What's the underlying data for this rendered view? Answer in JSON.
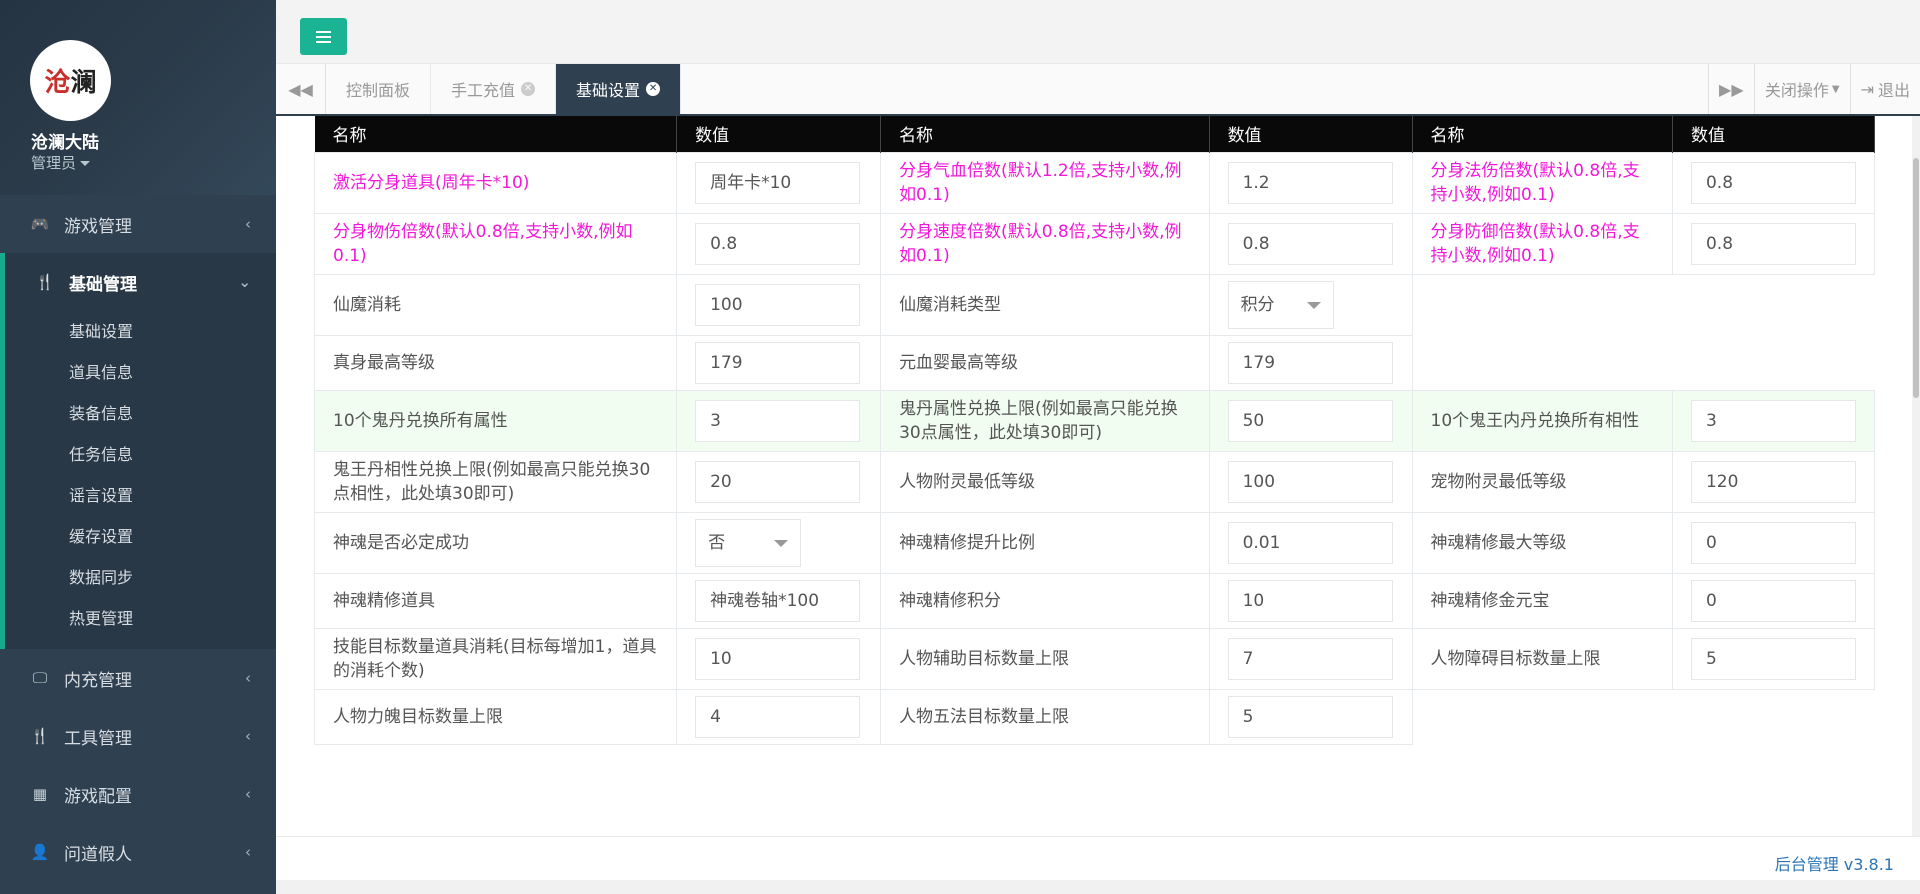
{
  "sidebar": {
    "name": "沧澜大陆",
    "role": "管理员",
    "logo": [
      "沧",
      "澜"
    ],
    "groups": [
      {
        "label": "游戏管理",
        "icon": "gamepad-icon"
      },
      {
        "label": "基础管理",
        "icon": "cutlery-icon",
        "active": true,
        "children": [
          "基础设置",
          "道具信息",
          "装备信息",
          "任务信息",
          "谣言设置",
          "缓存设置",
          "数据同步",
          "热更管理"
        ]
      },
      {
        "label": "内充管理",
        "icon": "desktop-icon"
      },
      {
        "label": "工具管理",
        "icon": "cutlery-icon"
      },
      {
        "label": "游戏配置",
        "icon": "table-icon"
      },
      {
        "label": "问道假人",
        "icon": "user-icon"
      }
    ]
  },
  "tabs": [
    {
      "label": "控制面板",
      "closable": false
    },
    {
      "label": "手工充值",
      "closable": true
    },
    {
      "label": "基础设置",
      "closable": true,
      "active": true
    }
  ],
  "tabbar": {
    "close_ops": "关闭操作",
    "logout": "退出"
  },
  "table": {
    "headers": [
      "名称",
      "数值",
      "名称",
      "数值",
      "名称",
      "数值"
    ],
    "rows": [
      {
        "style": "pink",
        "cells": [
          {
            "label": "激活分身道具(周年卡*10)",
            "value": "周年卡*10"
          },
          {
            "label": "分身气血倍数(默认1.2倍,支持小数,例如0.1)",
            "value": "1.2"
          },
          {
            "label": "分身法伤倍数(默认0.8倍,支持小数,例如0.1)",
            "value": "0.8"
          }
        ]
      },
      {
        "style": "pink",
        "cells": [
          {
            "label": "分身物伤倍数(默认0.8倍,支持小数,例如0.1)",
            "value": "0.8"
          },
          {
            "label": "分身速度倍数(默认0.8倍,支持小数,例如0.1)",
            "value": "0.8"
          },
          {
            "label": "分身防御倍数(默认0.8倍,支持小数,例如0.1)",
            "value": "0.8"
          }
        ]
      },
      {
        "style": "",
        "cells": [
          {
            "label": "仙魔消耗",
            "value": "100"
          },
          {
            "label": "仙魔消耗类型",
            "value": "积分",
            "select": true
          }
        ]
      },
      {
        "style": "",
        "cells": [
          {
            "label": "真身最高等级",
            "value": "179"
          },
          {
            "label": "元血婴最高等级",
            "value": "179"
          }
        ]
      },
      {
        "style": "green",
        "cells": [
          {
            "label": "10个鬼丹兑换所有属性",
            "value": "3"
          },
          {
            "label": "鬼丹属性兑换上限(例如最高只能兑换30点属性，此处填30即可)",
            "value": "50"
          },
          {
            "label": "10个鬼王内丹兑换所有相性",
            "value": "3"
          }
        ]
      },
      {
        "style": "",
        "cells": [
          {
            "label": "鬼王丹相性兑换上限(例如最高只能兑换30点相性，此处填30即可)",
            "value": "20"
          },
          {
            "label": "人物附灵最低等级",
            "value": "100"
          },
          {
            "label": "宠物附灵最低等级",
            "value": "120"
          }
        ]
      },
      {
        "style": "",
        "cells": [
          {
            "label": "神魂是否必定成功",
            "value": "否",
            "select": true
          },
          {
            "label": "神魂精修提升比例",
            "value": "0.01"
          },
          {
            "label": "神魂精修最大等级",
            "value": "0"
          }
        ]
      },
      {
        "style": "",
        "cells": [
          {
            "label": "神魂精修道具",
            "value": "神魂卷轴*100"
          },
          {
            "label": "神魂精修积分",
            "value": "10"
          },
          {
            "label": "神魂精修金元宝",
            "value": "0"
          }
        ]
      },
      {
        "style": "",
        "cells": [
          {
            "label": "技能目标数量道具消耗(目标每增加1，道具的消耗个数)",
            "value": "10"
          },
          {
            "label": "人物辅助目标数量上限",
            "value": "7"
          },
          {
            "label": "人物障碍目标数量上限",
            "value": "5"
          }
        ]
      },
      {
        "style": "",
        "cells": [
          {
            "label": "人物力魄目标数量上限",
            "value": "4"
          },
          {
            "label": "人物五法目标数量上限",
            "value": "5"
          }
        ]
      }
    ]
  },
  "footer": {
    "version": "后台管理 v3.8.1"
  }
}
